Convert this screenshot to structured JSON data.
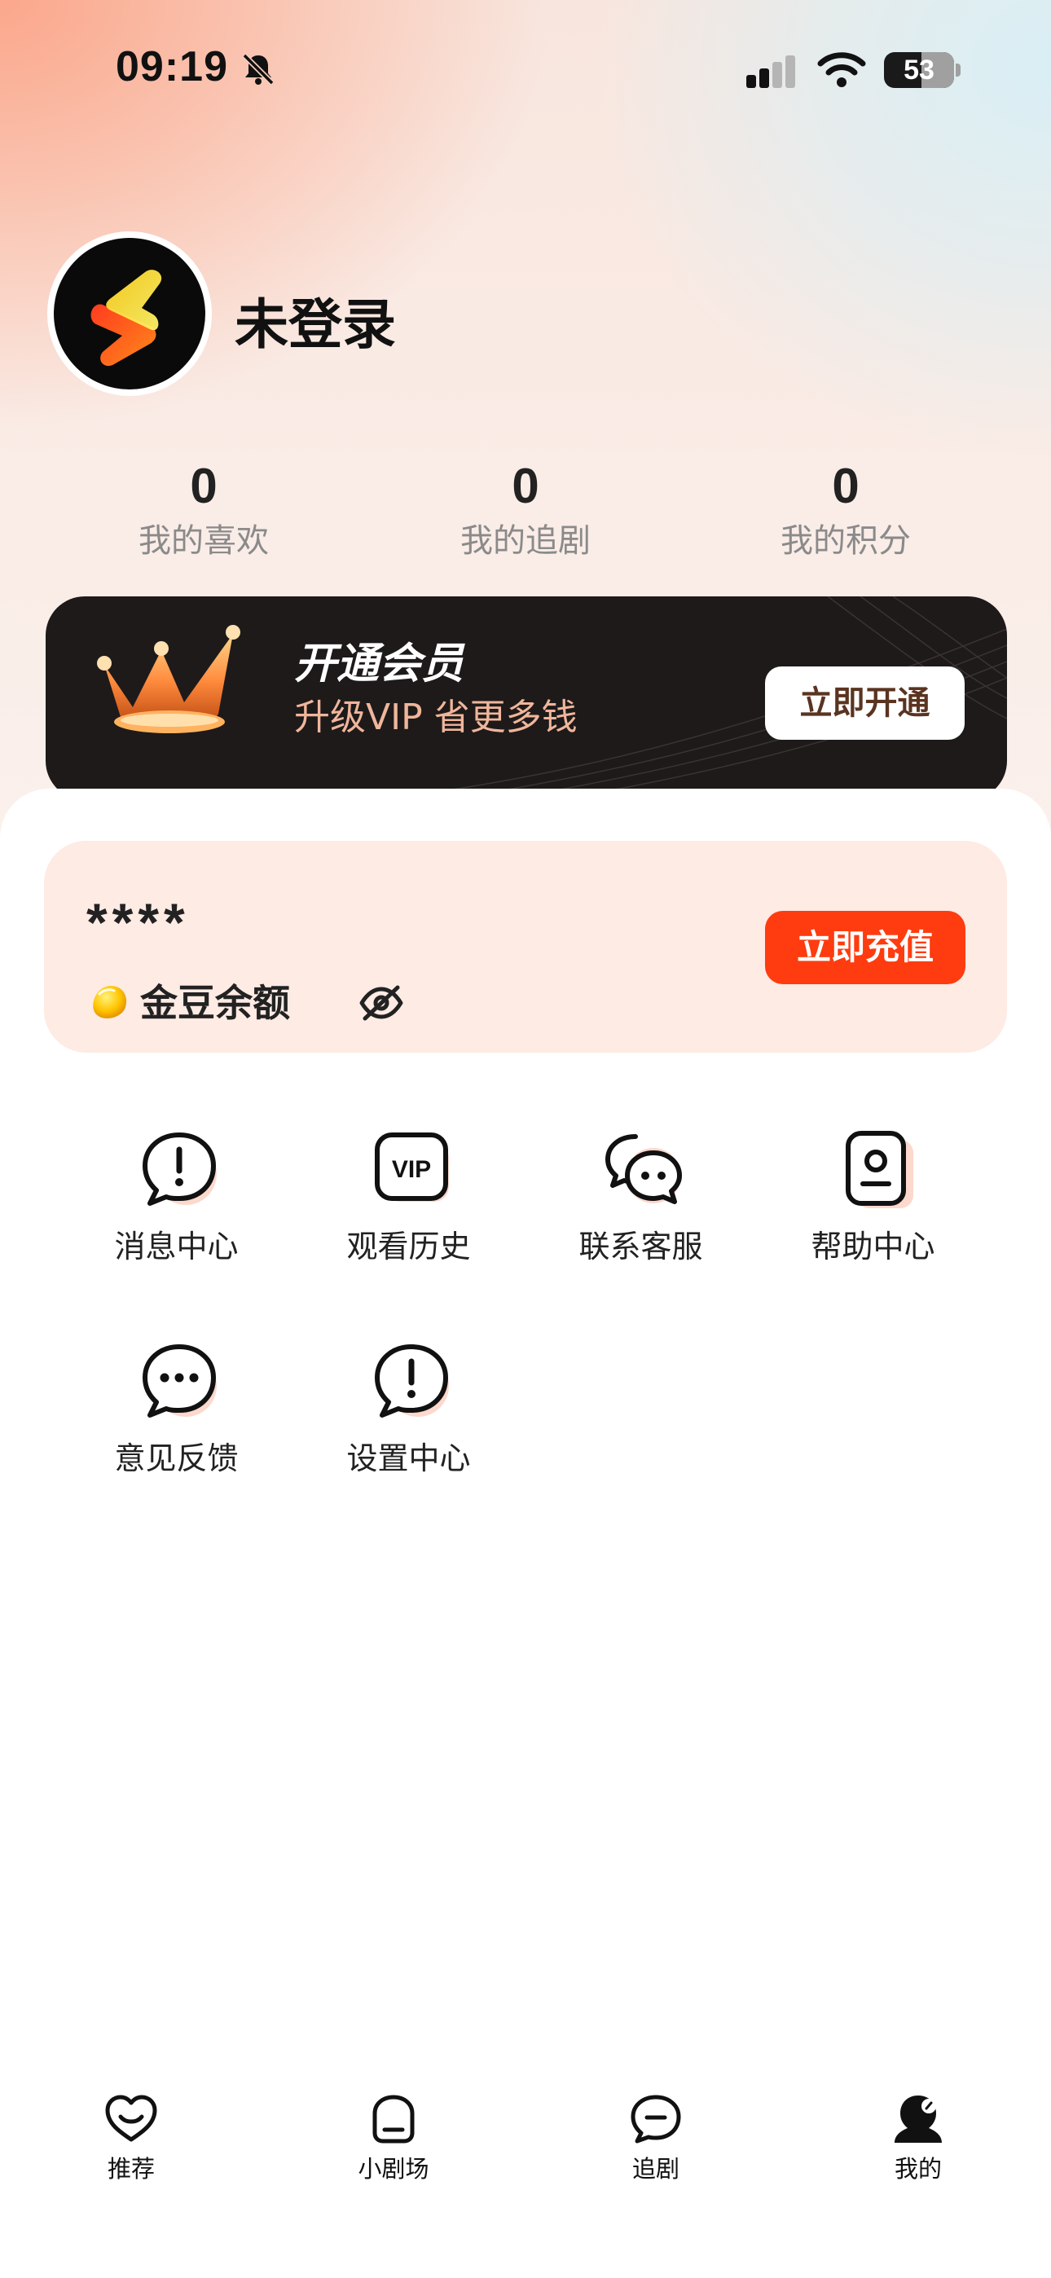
{
  "status_bar": {
    "time": "09:19",
    "battery": "53"
  },
  "profile": {
    "username": "未登录"
  },
  "stats": [
    {
      "value": "0",
      "label": "我的喜欢"
    },
    {
      "value": "0",
      "label": "我的追剧"
    },
    {
      "value": "0",
      "label": "我的积分"
    }
  ],
  "vip": {
    "title": "开通会员",
    "subtitle": "升级VIP 省更多钱",
    "button": "立即开通"
  },
  "balance": {
    "masked_value": "****",
    "label": "金豆余额",
    "button": "立即充值"
  },
  "menu": [
    {
      "label": "消息中心",
      "icon": "alert-bubble-icon"
    },
    {
      "label": "观看历史",
      "icon": "vip-badge-icon"
    },
    {
      "label": "联系客服",
      "icon": "chat-bubbles-icon"
    },
    {
      "label": "帮助中心",
      "icon": "id-card-icon"
    },
    {
      "label": "意见反馈",
      "icon": "dots-bubble-icon"
    },
    {
      "label": "设置中心",
      "icon": "alert-bubble-icon"
    }
  ],
  "tabs": [
    {
      "label": "推荐",
      "icon": "heart-smile-icon"
    },
    {
      "label": "小剧场",
      "icon": "theater-icon"
    },
    {
      "label": "追剧",
      "icon": "chat-minus-icon"
    },
    {
      "label": "我的",
      "icon": "profile-filled-icon",
      "active": true
    }
  ],
  "colors": {
    "accent": "#fe3c0f",
    "banner": "#1e1a1a",
    "card": "#fdebe4"
  }
}
